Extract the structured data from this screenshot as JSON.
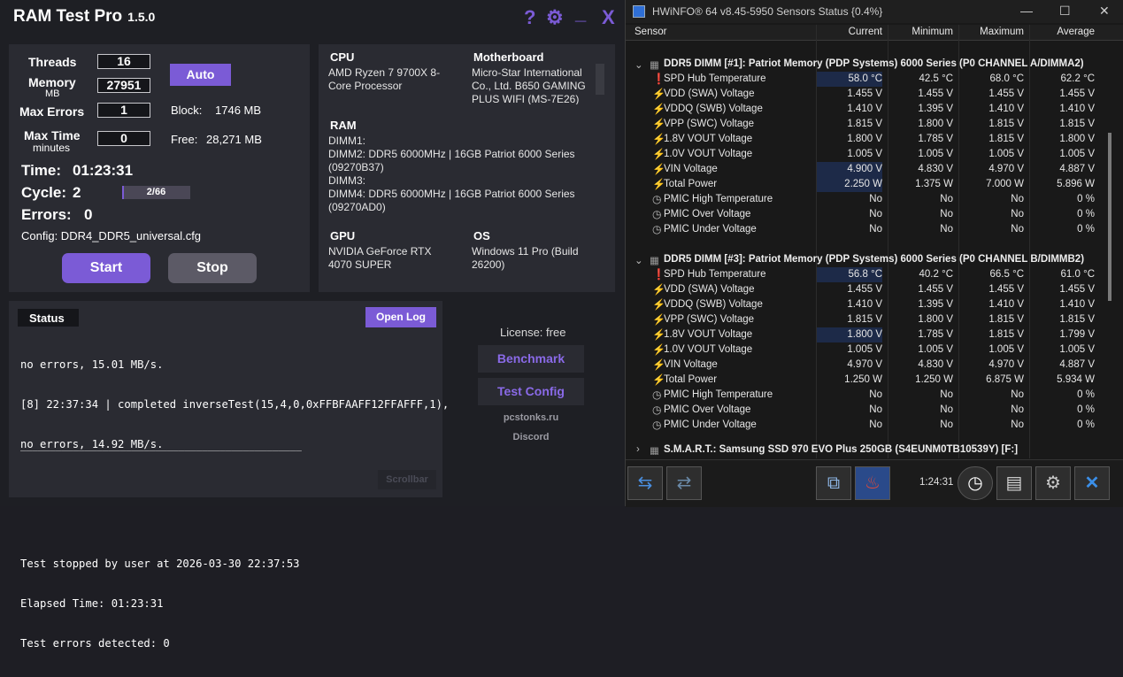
{
  "ramtest": {
    "app_title": "RAM Test Pro",
    "version": "1.5.0",
    "controls": {
      "help": "?",
      "settings": "⚙",
      "minimize": "_",
      "close": "X"
    },
    "settings": {
      "threads_label": "Threads",
      "threads_value": "16",
      "memory_label": "Memory",
      "memory_unit": "MB",
      "memory_value": "27951",
      "max_errors_label": "Max Errors",
      "max_errors_value": "1",
      "max_time_label": "Max Time",
      "max_time_unit": "minutes",
      "max_time_value": "0",
      "auto_button": "Auto",
      "block_label": "Block:",
      "block_value": "1746 MB",
      "free_label": "Free:",
      "free_value": "28,271 MB"
    },
    "stats": {
      "time_label": "Time:",
      "time_value": "01:23:31",
      "cycle_label": "Cycle:",
      "cycle_value": "2",
      "cycle_progress": "2/66",
      "cycle_progress_fraction": 0.0303,
      "errors_label": "Errors:",
      "errors_value": "0",
      "config_text": "Config: DDR4_DDR5_universal.cfg"
    },
    "buttons": {
      "start": "Start",
      "stop": "Stop"
    },
    "system": {
      "cpu_title": "CPU",
      "cpu_line1": "AMD Ryzen 7 9700X 8-",
      "cpu_line2": "Core Processor",
      "mb_title": "Motherboard",
      "mb_line1": "Micro-Star International",
      "mb_line2": "Co., Ltd. B650 GAMING",
      "mb_line3": "PLUS WIFI (MS-7E26)",
      "ram_title": "RAM",
      "ram_lines": [
        "DIMM1:",
        "DIMM2: DDR5 6000MHz | 16GB Patriot 6000 Series",
        "(09270B37)",
        "DIMM3:",
        "DIMM4: DDR5 6000MHz | 16GB Patriot 6000 Series",
        "(09270AD0)"
      ],
      "gpu_title": "GPU",
      "gpu_line1": "NVIDIA GeForce RTX",
      "gpu_line2": "4070 SUPER",
      "os_title": "OS",
      "os_line1": "Windows 11 Pro (Build",
      "os_line2": "26200)"
    },
    "status": {
      "title": "Status",
      "open_log": "Open Log",
      "lines": [
        "no errors, 15.01 MB/s.",
        "[8] 22:37:34 | completed inverseTest(15,4,0,0xFFBFAAFF12FFAFFF,1),",
        "no errors, 14.92 MB/s.",
        "",
        "",
        "Test stopped by user at 2026-03-30 22:37:53",
        "Elapsed Time: 01:23:31",
        "Test errors detected: 0"
      ],
      "separator": "________________________________________________",
      "scrollbar": "Scrollbar"
    },
    "side": {
      "license": "License: free",
      "benchmark": "Benchmark",
      "test_config": "Test Config",
      "site": "pcstonks.ru",
      "discord": "Discord"
    },
    "colors": {
      "accent": "#7b5bd6",
      "background": "#1e1f24",
      "panel": "#2a2b32"
    }
  },
  "hwinfo": {
    "title": "HWiNFO® 64 v8.45-5950 Sensors Status {0.4%}",
    "columns": [
      "Sensor",
      "Current",
      "Minimum",
      "Maximum",
      "Average"
    ],
    "groups": [
      {
        "name": "DDR5 DIMM [#1]: Patriot Memory (PDP Systems) 6000 Series (P0 CHANNEL A/DIMMA2)",
        "rows": [
          {
            "icon": "thermometer-icon",
            "name": "SPD Hub Temperature",
            "cur": "58.0 °C",
            "min": "42.5 °C",
            "max": "68.0 °C",
            "avg": "62.2 °C",
            "hl": true
          },
          {
            "icon": "bolt-icon",
            "name": "VDD (SWA) Voltage",
            "cur": "1.455 V",
            "min": "1.455 V",
            "max": "1.455 V",
            "avg": "1.455 V",
            "hl": false
          },
          {
            "icon": "bolt-icon",
            "name": "VDDQ (SWB) Voltage",
            "cur": "1.410 V",
            "min": "1.395 V",
            "max": "1.410 V",
            "avg": "1.410 V",
            "hl": false
          },
          {
            "icon": "bolt-icon",
            "name": "VPP (SWC) Voltage",
            "cur": "1.815 V",
            "min": "1.800 V",
            "max": "1.815 V",
            "avg": "1.815 V",
            "hl": false
          },
          {
            "icon": "bolt-icon",
            "name": "1.8V VOUT Voltage",
            "cur": "1.800 V",
            "min": "1.785 V",
            "max": "1.815 V",
            "avg": "1.800 V",
            "hl": false
          },
          {
            "icon": "bolt-icon",
            "name": "1.0V VOUT Voltage",
            "cur": "1.005 V",
            "min": "1.005 V",
            "max": "1.005 V",
            "avg": "1.005 V",
            "hl": false
          },
          {
            "icon": "bolt-icon",
            "name": "VIN Voltage",
            "cur": "4.900 V",
            "min": "4.830 V",
            "max": "4.970 V",
            "avg": "4.887 V",
            "hl": true
          },
          {
            "icon": "bolt-icon",
            "name": "Total Power",
            "cur": "2.250 W",
            "min": "1.375 W",
            "max": "7.000 W",
            "avg": "5.896 W",
            "hl": true
          },
          {
            "icon": "clock-icon",
            "name": "PMIC High Temperature",
            "cur": "No",
            "min": "No",
            "max": "No",
            "avg": "0 %",
            "hl": false
          },
          {
            "icon": "clock-icon",
            "name": "PMIC Over Voltage",
            "cur": "No",
            "min": "No",
            "max": "No",
            "avg": "0 %",
            "hl": false
          },
          {
            "icon": "clock-icon",
            "name": "PMIC Under Voltage",
            "cur": "No",
            "min": "No",
            "max": "No",
            "avg": "0 %",
            "hl": false
          }
        ]
      },
      {
        "name": "DDR5 DIMM [#3]: Patriot Memory (PDP Systems) 6000 Series (P0 CHANNEL B/DIMMB2)",
        "rows": [
          {
            "icon": "thermometer-icon",
            "name": "SPD Hub Temperature",
            "cur": "56.8 °C",
            "min": "40.2 °C",
            "max": "66.5 °C",
            "avg": "61.0 °C",
            "hl": true
          },
          {
            "icon": "bolt-icon",
            "name": "VDD (SWA) Voltage",
            "cur": "1.455 V",
            "min": "1.455 V",
            "max": "1.455 V",
            "avg": "1.455 V",
            "hl": false
          },
          {
            "icon": "bolt-icon",
            "name": "VDDQ (SWB) Voltage",
            "cur": "1.410 V",
            "min": "1.395 V",
            "max": "1.410 V",
            "avg": "1.410 V",
            "hl": false
          },
          {
            "icon": "bolt-icon",
            "name": "VPP (SWC) Voltage",
            "cur": "1.815 V",
            "min": "1.800 V",
            "max": "1.815 V",
            "avg": "1.815 V",
            "hl": false
          },
          {
            "icon": "bolt-icon",
            "name": "1.8V VOUT Voltage",
            "cur": "1.800 V",
            "min": "1.785 V",
            "max": "1.815 V",
            "avg": "1.799 V",
            "hl": true
          },
          {
            "icon": "bolt-icon",
            "name": "1.0V VOUT Voltage",
            "cur": "1.005 V",
            "min": "1.005 V",
            "max": "1.005 V",
            "avg": "1.005 V",
            "hl": false
          },
          {
            "icon": "bolt-icon",
            "name": "VIN Voltage",
            "cur": "4.970 V",
            "min": "4.830 V",
            "max": "4.970 V",
            "avg": "4.887 V",
            "hl": false
          },
          {
            "icon": "bolt-icon",
            "name": "Total Power",
            "cur": "1.250 W",
            "min": "1.250 W",
            "max": "6.875 W",
            "avg": "5.934 W",
            "hl": false
          },
          {
            "icon": "clock-icon",
            "name": "PMIC High Temperature",
            "cur": "No",
            "min": "No",
            "max": "No",
            "avg": "0 %",
            "hl": false
          },
          {
            "icon": "clock-icon",
            "name": "PMIC Over Voltage",
            "cur": "No",
            "min": "No",
            "max": "No",
            "avg": "0 %",
            "hl": false
          },
          {
            "icon": "clock-icon",
            "name": "PMIC Under Voltage",
            "cur": "No",
            "min": "No",
            "max": "No",
            "avg": "0 %",
            "hl": false
          }
        ]
      }
    ],
    "collapsed_group": "S.M.A.R.T.: Samsung SSD 970 EVO Plus 250GB (S4EUNM0TB10539Y) [F:]",
    "elapsed": "1:24:31"
  }
}
